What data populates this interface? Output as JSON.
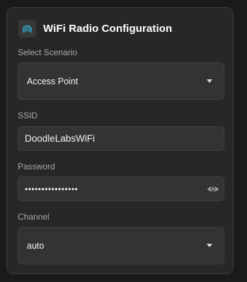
{
  "header": {
    "title": "WiFi Radio Configuration",
    "icon": "wifi-radio-icon",
    "accent_color": "#2fb7d9"
  },
  "scenario": {
    "label": "Select Scenario",
    "value": "Access Point"
  },
  "ssid": {
    "label": "SSID",
    "value": "DoodleLabsWiFi"
  },
  "password": {
    "label": "Password",
    "value": "••••••••••••••••",
    "toggle_icon": "eye-icon"
  },
  "channel": {
    "label": "Channel",
    "value": "auto"
  }
}
